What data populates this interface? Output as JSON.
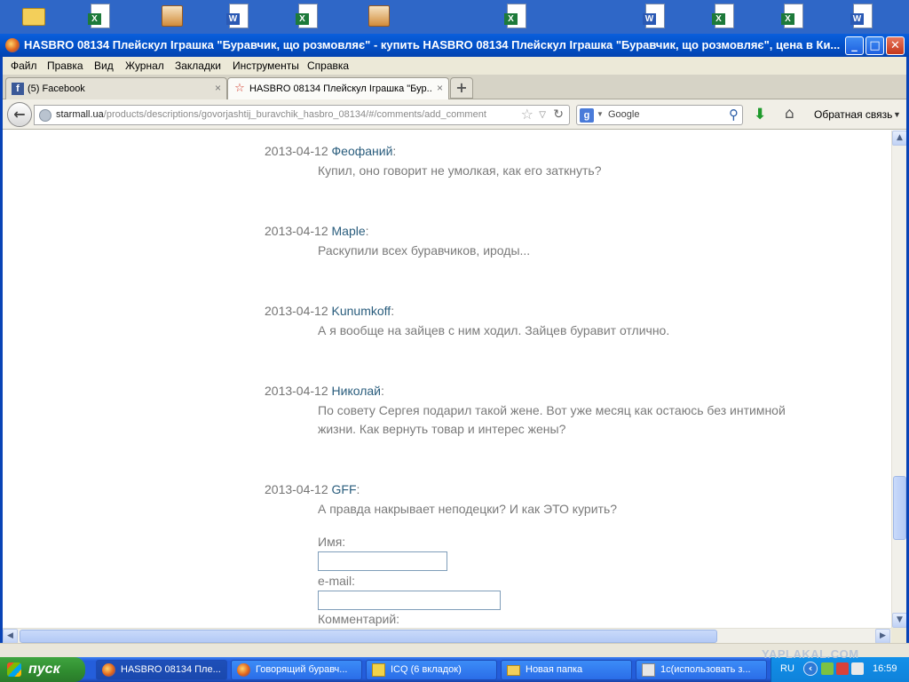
{
  "desktop": {
    "icons": [
      {
        "name": "folder-icon",
        "kind": "folder"
      },
      {
        "name": "excel-file-icon",
        "kind": "x"
      },
      {
        "name": "archive-box-icon",
        "kind": "box"
      },
      {
        "name": "word-file-icon",
        "kind": "w"
      },
      {
        "name": "excel-file-icon",
        "kind": "x"
      },
      {
        "name": "archive-box-icon",
        "kind": "box"
      },
      {
        "name": "excel-file-icon",
        "kind": "x"
      },
      {
        "name": "word-file-icon",
        "kind": "w"
      },
      {
        "name": "excel-file-icon",
        "kind": "x"
      },
      {
        "name": "excel-file-icon",
        "kind": "x"
      },
      {
        "name": "word-file-icon",
        "kind": "w"
      }
    ]
  },
  "window": {
    "title": "HASBRO 08134 Плейскул Іграшка \"Буравчик, що розмовляє\" - купить HASBRO 08134 Плейскул Іграшка \"Буравчик, що розмовляє\", цена в Ки...",
    "controls": {
      "minimize": "_",
      "maximize": "□",
      "close": "✕"
    }
  },
  "menu": [
    "Файл",
    "Правка",
    "Вид",
    "Журнал",
    "Закладки",
    "Инструменты",
    "Справка"
  ],
  "tabs": [
    {
      "label": "(5) Facebook",
      "icon": "facebook-icon",
      "icon_glyph": "f",
      "close": "×",
      "active": false
    },
    {
      "label": "HASBRO 08134 Плейскул Іграшка \"Бур...",
      "icon": "starmall-icon",
      "icon_glyph": "☆",
      "close": "×",
      "active": true
    }
  ],
  "new_tab": "+",
  "nav": {
    "back": "←",
    "url_host": "starmall.ua",
    "url_path": "/products/descriptions/govorjashtij_buravchik_hasbro_08134/#/comments/add_comment",
    "star": "☆",
    "dropdown": "▽",
    "reload": "↻",
    "search_engine": "g",
    "search_placeholder": "Google",
    "search_button": "⚲",
    "download": "⬇",
    "home": "⌂",
    "feedback": "Обратная связь",
    "feedback_dropdown": "▼"
  },
  "comments": [
    {
      "date": "2013-04-12",
      "author": "Феофаний",
      "text": "Купил, оно говорит не умолкая, как его заткнуть?"
    },
    {
      "date": "2013-04-12",
      "author": "Maple",
      "text": "Раскупили всех буравчиков, ироды..."
    },
    {
      "date": "2013-04-12",
      "author": "Kunumkoff",
      "text": "А я вообще на зайцев с ним ходил. Зайцев буравит отлично."
    },
    {
      "date": "2013-04-12",
      "author": "Николай",
      "text": "По совету Сергея подарил такой жене. Вот уже месяц как остаюсь без интимной жизни. Как вернуть товар и интерес жены?"
    },
    {
      "date": "2013-04-12",
      "author": "GFF",
      "text": "А правда накрывает неподецки? И как ЭТО курить?"
    }
  ],
  "form": {
    "name_label": "Имя:",
    "email_label": "e-mail:",
    "comment_label": "Комментарий:"
  },
  "scroll": {
    "up": "▲",
    "down": "▼",
    "left": "◀",
    "right": "▶",
    "vertical_position": 0.82
  },
  "taskbar": {
    "start": "пуск",
    "tasks": [
      {
        "label": "HASBRO 08134 Плe...",
        "icon": "firefox-icon",
        "active": true
      },
      {
        "label": "Говорящий буравч...",
        "icon": "firefox-icon",
        "active": false
      },
      {
        "label": "ICQ (6 вкладок)",
        "icon": "icq-icon",
        "active": false
      },
      {
        "label": "Новая папка",
        "icon": "folder-icon",
        "active": false
      },
      {
        "label": "1с(использовать з...",
        "icon": "app-icon",
        "active": false
      }
    ],
    "lang": "RU",
    "tray_arrow": "‹",
    "clock": "16:59"
  },
  "watermark": "YAPLAKAL.COM"
}
